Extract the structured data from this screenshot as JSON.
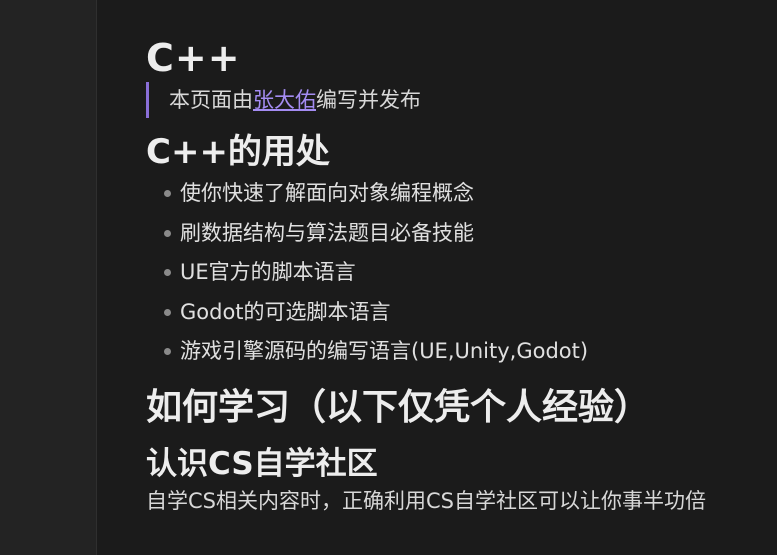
{
  "article": {
    "title": "C++",
    "byline": {
      "prefix": "本页面由",
      "author": "张大佑",
      "suffix": "编写并发布"
    },
    "uses": {
      "heading": "C++的用处",
      "items": [
        "使你快速了解面向对象编程概念",
        "刷数据结构与算法题目必备技能",
        "UE官方的脚本语言",
        "Godot的可选脚本语言",
        "游戏引擎源码的编写语言(UE,Unity,Godot)"
      ]
    },
    "learn": {
      "heading": "如何学习（以下仅凭个人经验）",
      "sub_heading": "认识CS自学社区",
      "paragraph": "自学CS相关内容时，正确利用CS自学社区可以让你事半功倍"
    }
  },
  "colors": {
    "background": "#1b1b1b",
    "sidebar": "#232323",
    "accent": "#8a6fd8",
    "link": "#a48cf2",
    "text": "#e6e6e6"
  }
}
